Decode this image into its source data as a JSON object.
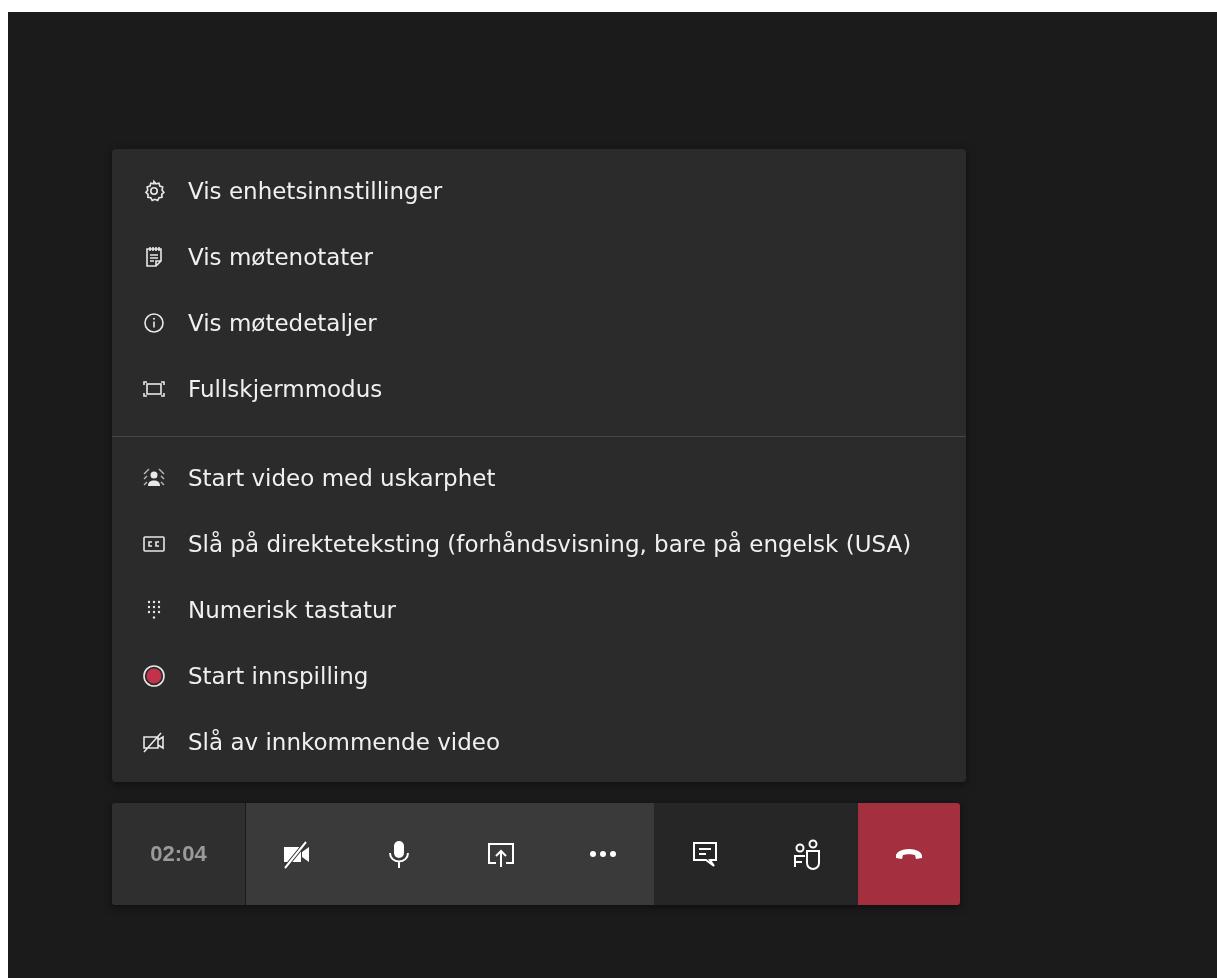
{
  "menu": {
    "groups": [
      {
        "items": [
          {
            "kind": "gear",
            "label": "Vis enhetsinnstillinger"
          },
          {
            "kind": "notes",
            "label": "Vis møtenotater"
          },
          {
            "kind": "info",
            "label": "Vis møtedetaljer"
          },
          {
            "kind": "fullscreen",
            "label": "Fullskjermmodus"
          }
        ]
      },
      {
        "items": [
          {
            "kind": "blur",
            "label": "Start video med uskarphet"
          },
          {
            "kind": "cc",
            "label": "Slå på direkteteksting (forhåndsvisning, bare på engelsk (USA)"
          },
          {
            "kind": "dialpad",
            "label": "Numerisk tastatur"
          },
          {
            "kind": "record",
            "label": "Start innspilling"
          },
          {
            "kind": "video-off",
            "label": "Slå av innkommende video"
          }
        ]
      }
    ]
  },
  "toolbar": {
    "timer": "02:04",
    "buttons": [
      {
        "kind": "camera-off"
      },
      {
        "kind": "mic"
      },
      {
        "kind": "share"
      },
      {
        "kind": "more"
      },
      {
        "kind": "chat"
      },
      {
        "kind": "participants"
      },
      {
        "kind": "hang-up"
      }
    ]
  }
}
